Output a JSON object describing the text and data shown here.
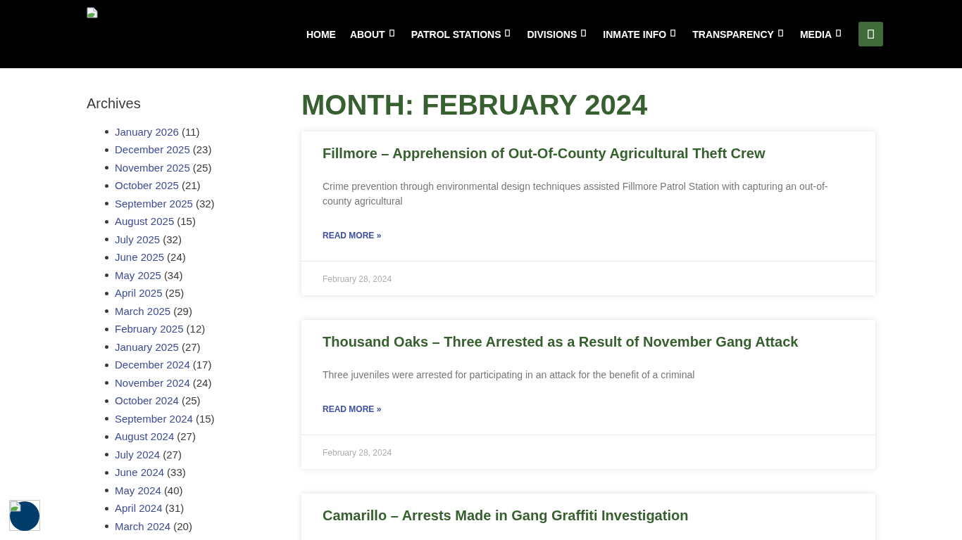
{
  "header": {
    "nav": [
      {
        "label": "HOME",
        "dropdown": false
      },
      {
        "label": "ABOUT",
        "dropdown": true
      },
      {
        "label": "PATROL STATIONS",
        "dropdown": true
      },
      {
        "label": "DIVISIONS",
        "dropdown": true
      },
      {
        "label": "INMATE INFO",
        "dropdown": true
      },
      {
        "label": "TRANSPARENCY",
        "dropdown": true
      },
      {
        "label": "MEDIA",
        "dropdown": true
      }
    ]
  },
  "sidebar": {
    "title": "Archives",
    "items": [
      {
        "label": "January 2026",
        "count": "(11)"
      },
      {
        "label": "December 2025",
        "count": "(23)"
      },
      {
        "label": "November 2025",
        "count": "(25)"
      },
      {
        "label": "October 2025",
        "count": "(21)"
      },
      {
        "label": "September 2025",
        "count": "(32)"
      },
      {
        "label": "August 2025",
        "count": "(15)"
      },
      {
        "label": "July 2025",
        "count": "(32)"
      },
      {
        "label": "June 2025",
        "count": "(24)"
      },
      {
        "label": "May 2025",
        "count": "(34)"
      },
      {
        "label": "April 2025",
        "count": "(25)"
      },
      {
        "label": "March 2025",
        "count": "(29)"
      },
      {
        "label": "February 2025",
        "count": "(12)"
      },
      {
        "label": "January 2025",
        "count": "(27)"
      },
      {
        "label": "December 2024",
        "count": "(17)"
      },
      {
        "label": "November 2024",
        "count": "(24)"
      },
      {
        "label": "October 2024",
        "count": "(25)"
      },
      {
        "label": "September 2024",
        "count": "(15)"
      },
      {
        "label": "August 2024",
        "count": "(27)"
      },
      {
        "label": "July 2024",
        "count": "(27)"
      },
      {
        "label": "June 2024",
        "count": "(33)"
      },
      {
        "label": "May 2024",
        "count": "(40)"
      },
      {
        "label": "April 2024",
        "count": "(31)"
      },
      {
        "label": "March 2024",
        "count": "(20)"
      }
    ]
  },
  "main": {
    "heading": "MONTH: FEBRUARY 2024",
    "posts": [
      {
        "title": "Fillmore – Apprehension of Out-Of-County Agricultural Theft Crew",
        "excerpt": "Crime prevention through environmental design techniques assisted Fillmore Patrol Station with capturing an out-of-county agricultural",
        "read_more": "READ MORE »",
        "date": "February 28, 2024"
      },
      {
        "title": "Thousand Oaks – Three Arrested as a Result of November Gang Attack",
        "excerpt": "Three juveniles were arrested for participating in an attack for the benefit of a criminal",
        "read_more": "READ MORE »",
        "date": "February 28, 2024"
      },
      {
        "title": "Camarillo – Arrests Made in Gang Graffiti Investigation"
      }
    ]
  }
}
